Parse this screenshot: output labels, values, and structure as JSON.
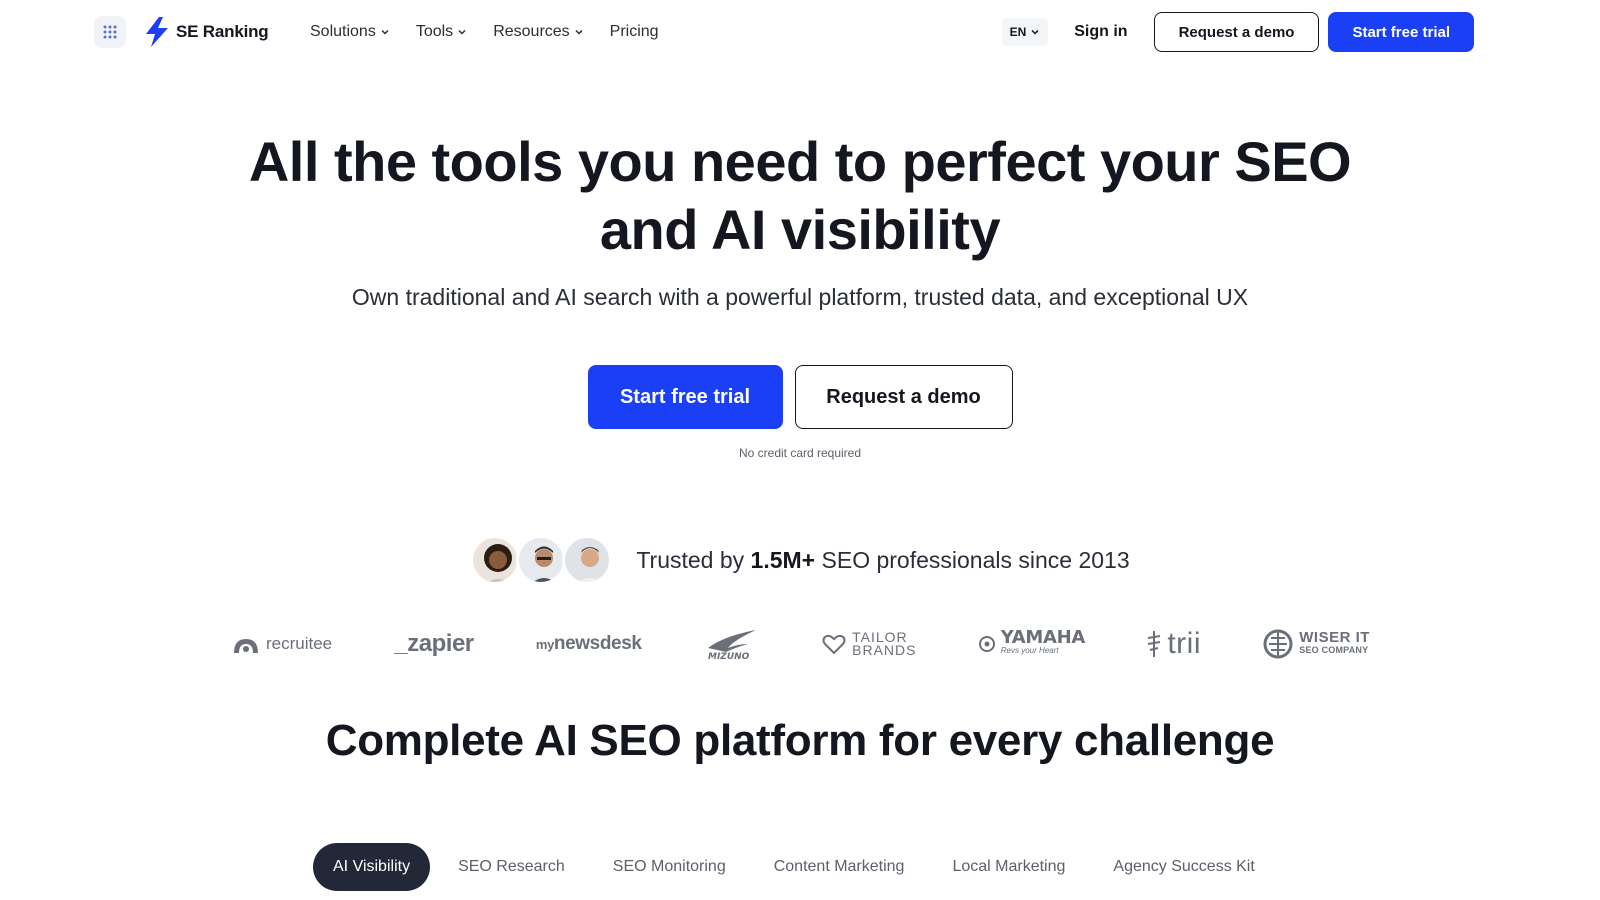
{
  "header": {
    "logo_text": "SE Ranking",
    "nav": [
      {
        "label": "Solutions",
        "has_dropdown": true
      },
      {
        "label": "Tools",
        "has_dropdown": true
      },
      {
        "label": "Resources",
        "has_dropdown": true
      },
      {
        "label": "Pricing",
        "has_dropdown": false
      }
    ],
    "lang": "EN",
    "sign_in": "Sign in",
    "request_demo": "Request a demo",
    "start_trial": "Start free trial"
  },
  "hero": {
    "title_line1": "All the tools you need to perfect your SEO",
    "title_line2": "and AI visibility",
    "subtitle": "Own traditional and AI search with a powerful platform, trusted data, and exceptional UX",
    "cta_primary": "Start free trial",
    "cta_secondary": "Request a demo",
    "note": "No credit card required"
  },
  "trust": {
    "prefix": "Trusted by",
    "count": "1.5M+",
    "suffix": "SEO professionals since 2013"
  },
  "logos": {
    "recruitee": "recruitee",
    "zapier": "_zapier",
    "newsdesk_my": "my",
    "newsdesk": "newsdesk",
    "mizuno": "Mizuno",
    "tailor_1": "TAILOR",
    "tailor_2": "BRANDS",
    "yamaha": "YAMAHA",
    "yamaha_tag": "Revs your Heart",
    "trii": "trii",
    "wiser_1": "WISER IT",
    "wiser_2": "SEO COMPANY"
  },
  "section": {
    "title": "Complete AI SEO platform for every challenge",
    "tabs": [
      "AI Visibility",
      "SEO Research",
      "SEO Monitoring",
      "Content Marketing",
      "Local Marketing",
      "Agency Success Kit"
    ],
    "active_tab_index": 0
  },
  "colors": {
    "brand_blue": "#1b3ff5",
    "dark": "#14171f",
    "active_tab_bg": "#222837"
  }
}
